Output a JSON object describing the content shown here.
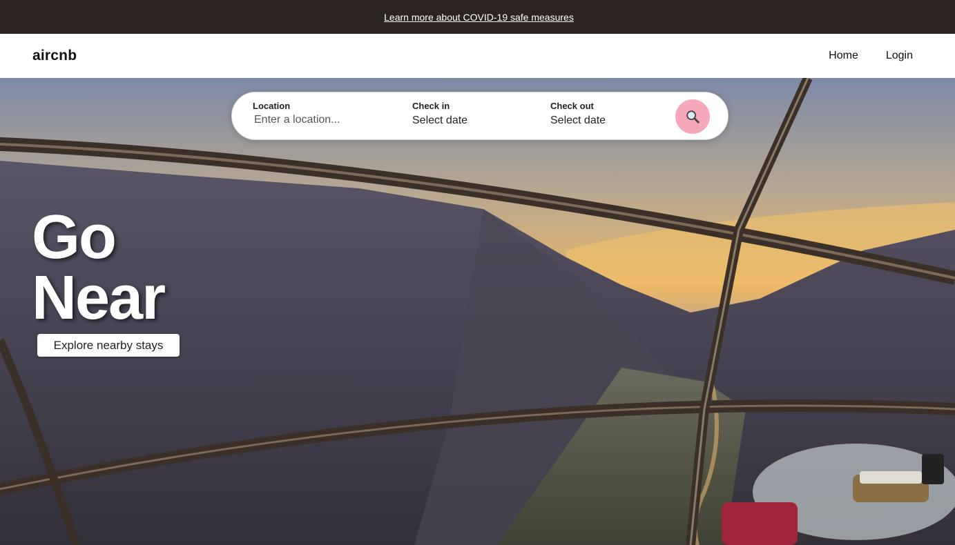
{
  "banner": {
    "link_text": "Learn more about COVID-19 safe measures"
  },
  "header": {
    "logo": "aircnb",
    "nav": [
      "Home",
      "Login"
    ]
  },
  "search": {
    "location_label": "Location",
    "location_placeholder": "Enter a location...",
    "checkin_label": "Check in",
    "checkin_value": "Select date",
    "checkout_label": "Check out",
    "checkout_value": "Select date",
    "button_icon": "search-icon"
  },
  "hero": {
    "headline_line1": "Go",
    "headline_line2": "Near",
    "cta_label": "Explore nearby stays"
  },
  "colors": {
    "banner_bg": "#2b2420",
    "search_button": "#f6a8bb"
  }
}
